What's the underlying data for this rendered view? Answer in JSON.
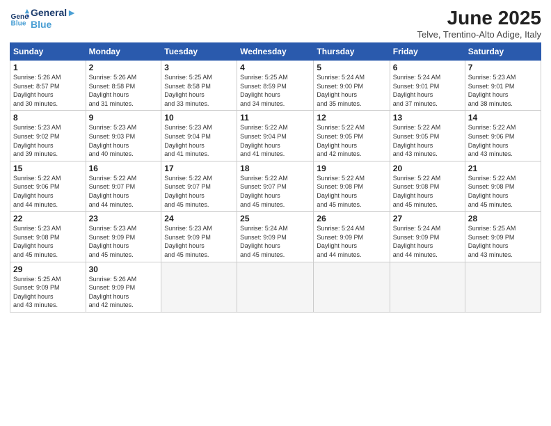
{
  "logo": {
    "line1": "General",
    "line2": "Blue"
  },
  "title": "June 2025",
  "subtitle": "Telve, Trentino-Alto Adige, Italy",
  "days_of_week": [
    "Sunday",
    "Monday",
    "Tuesday",
    "Wednesday",
    "Thursday",
    "Friday",
    "Saturday"
  ],
  "weeks": [
    [
      {
        "num": "1",
        "sunrise": "5:26 AM",
        "sunset": "8:57 PM",
        "daylight": "15 hours and 30 minutes."
      },
      {
        "num": "2",
        "sunrise": "5:26 AM",
        "sunset": "8:58 PM",
        "daylight": "15 hours and 31 minutes."
      },
      {
        "num": "3",
        "sunrise": "5:25 AM",
        "sunset": "8:58 PM",
        "daylight": "15 hours and 33 minutes."
      },
      {
        "num": "4",
        "sunrise": "5:25 AM",
        "sunset": "8:59 PM",
        "daylight": "15 hours and 34 minutes."
      },
      {
        "num": "5",
        "sunrise": "5:24 AM",
        "sunset": "9:00 PM",
        "daylight": "15 hours and 35 minutes."
      },
      {
        "num": "6",
        "sunrise": "5:24 AM",
        "sunset": "9:01 PM",
        "daylight": "15 hours and 37 minutes."
      },
      {
        "num": "7",
        "sunrise": "5:23 AM",
        "sunset": "9:01 PM",
        "daylight": "15 hours and 38 minutes."
      }
    ],
    [
      {
        "num": "8",
        "sunrise": "5:23 AM",
        "sunset": "9:02 PM",
        "daylight": "15 hours and 39 minutes."
      },
      {
        "num": "9",
        "sunrise": "5:23 AM",
        "sunset": "9:03 PM",
        "daylight": "15 hours and 40 minutes."
      },
      {
        "num": "10",
        "sunrise": "5:23 AM",
        "sunset": "9:04 PM",
        "daylight": "15 hours and 41 minutes."
      },
      {
        "num": "11",
        "sunrise": "5:22 AM",
        "sunset": "9:04 PM",
        "daylight": "15 hours and 41 minutes."
      },
      {
        "num": "12",
        "sunrise": "5:22 AM",
        "sunset": "9:05 PM",
        "daylight": "15 hours and 42 minutes."
      },
      {
        "num": "13",
        "sunrise": "5:22 AM",
        "sunset": "9:05 PM",
        "daylight": "15 hours and 43 minutes."
      },
      {
        "num": "14",
        "sunrise": "5:22 AM",
        "sunset": "9:06 PM",
        "daylight": "15 hours and 43 minutes."
      }
    ],
    [
      {
        "num": "15",
        "sunrise": "5:22 AM",
        "sunset": "9:06 PM",
        "daylight": "15 hours and 44 minutes."
      },
      {
        "num": "16",
        "sunrise": "5:22 AM",
        "sunset": "9:07 PM",
        "daylight": "15 hours and 44 minutes."
      },
      {
        "num": "17",
        "sunrise": "5:22 AM",
        "sunset": "9:07 PM",
        "daylight": "15 hours and 45 minutes."
      },
      {
        "num": "18",
        "sunrise": "5:22 AM",
        "sunset": "9:07 PM",
        "daylight": "15 hours and 45 minutes."
      },
      {
        "num": "19",
        "sunrise": "5:22 AM",
        "sunset": "9:08 PM",
        "daylight": "15 hours and 45 minutes."
      },
      {
        "num": "20",
        "sunrise": "5:22 AM",
        "sunset": "9:08 PM",
        "daylight": "15 hours and 45 minutes."
      },
      {
        "num": "21",
        "sunrise": "5:22 AM",
        "sunset": "9:08 PM",
        "daylight": "15 hours and 45 minutes."
      }
    ],
    [
      {
        "num": "22",
        "sunrise": "5:23 AM",
        "sunset": "9:08 PM",
        "daylight": "15 hours and 45 minutes."
      },
      {
        "num": "23",
        "sunrise": "5:23 AM",
        "sunset": "9:09 PM",
        "daylight": "15 hours and 45 minutes."
      },
      {
        "num": "24",
        "sunrise": "5:23 AM",
        "sunset": "9:09 PM",
        "daylight": "15 hours and 45 minutes."
      },
      {
        "num": "25",
        "sunrise": "5:24 AM",
        "sunset": "9:09 PM",
        "daylight": "15 hours and 45 minutes."
      },
      {
        "num": "26",
        "sunrise": "5:24 AM",
        "sunset": "9:09 PM",
        "daylight": "15 hours and 44 minutes."
      },
      {
        "num": "27",
        "sunrise": "5:24 AM",
        "sunset": "9:09 PM",
        "daylight": "15 hours and 44 minutes."
      },
      {
        "num": "28",
        "sunrise": "5:25 AM",
        "sunset": "9:09 PM",
        "daylight": "15 hours and 43 minutes."
      }
    ],
    [
      {
        "num": "29",
        "sunrise": "5:25 AM",
        "sunset": "9:09 PM",
        "daylight": "15 hours and 43 minutes."
      },
      {
        "num": "30",
        "sunrise": "5:26 AM",
        "sunset": "9:09 PM",
        "daylight": "15 hours and 42 minutes."
      },
      null,
      null,
      null,
      null,
      null
    ]
  ]
}
